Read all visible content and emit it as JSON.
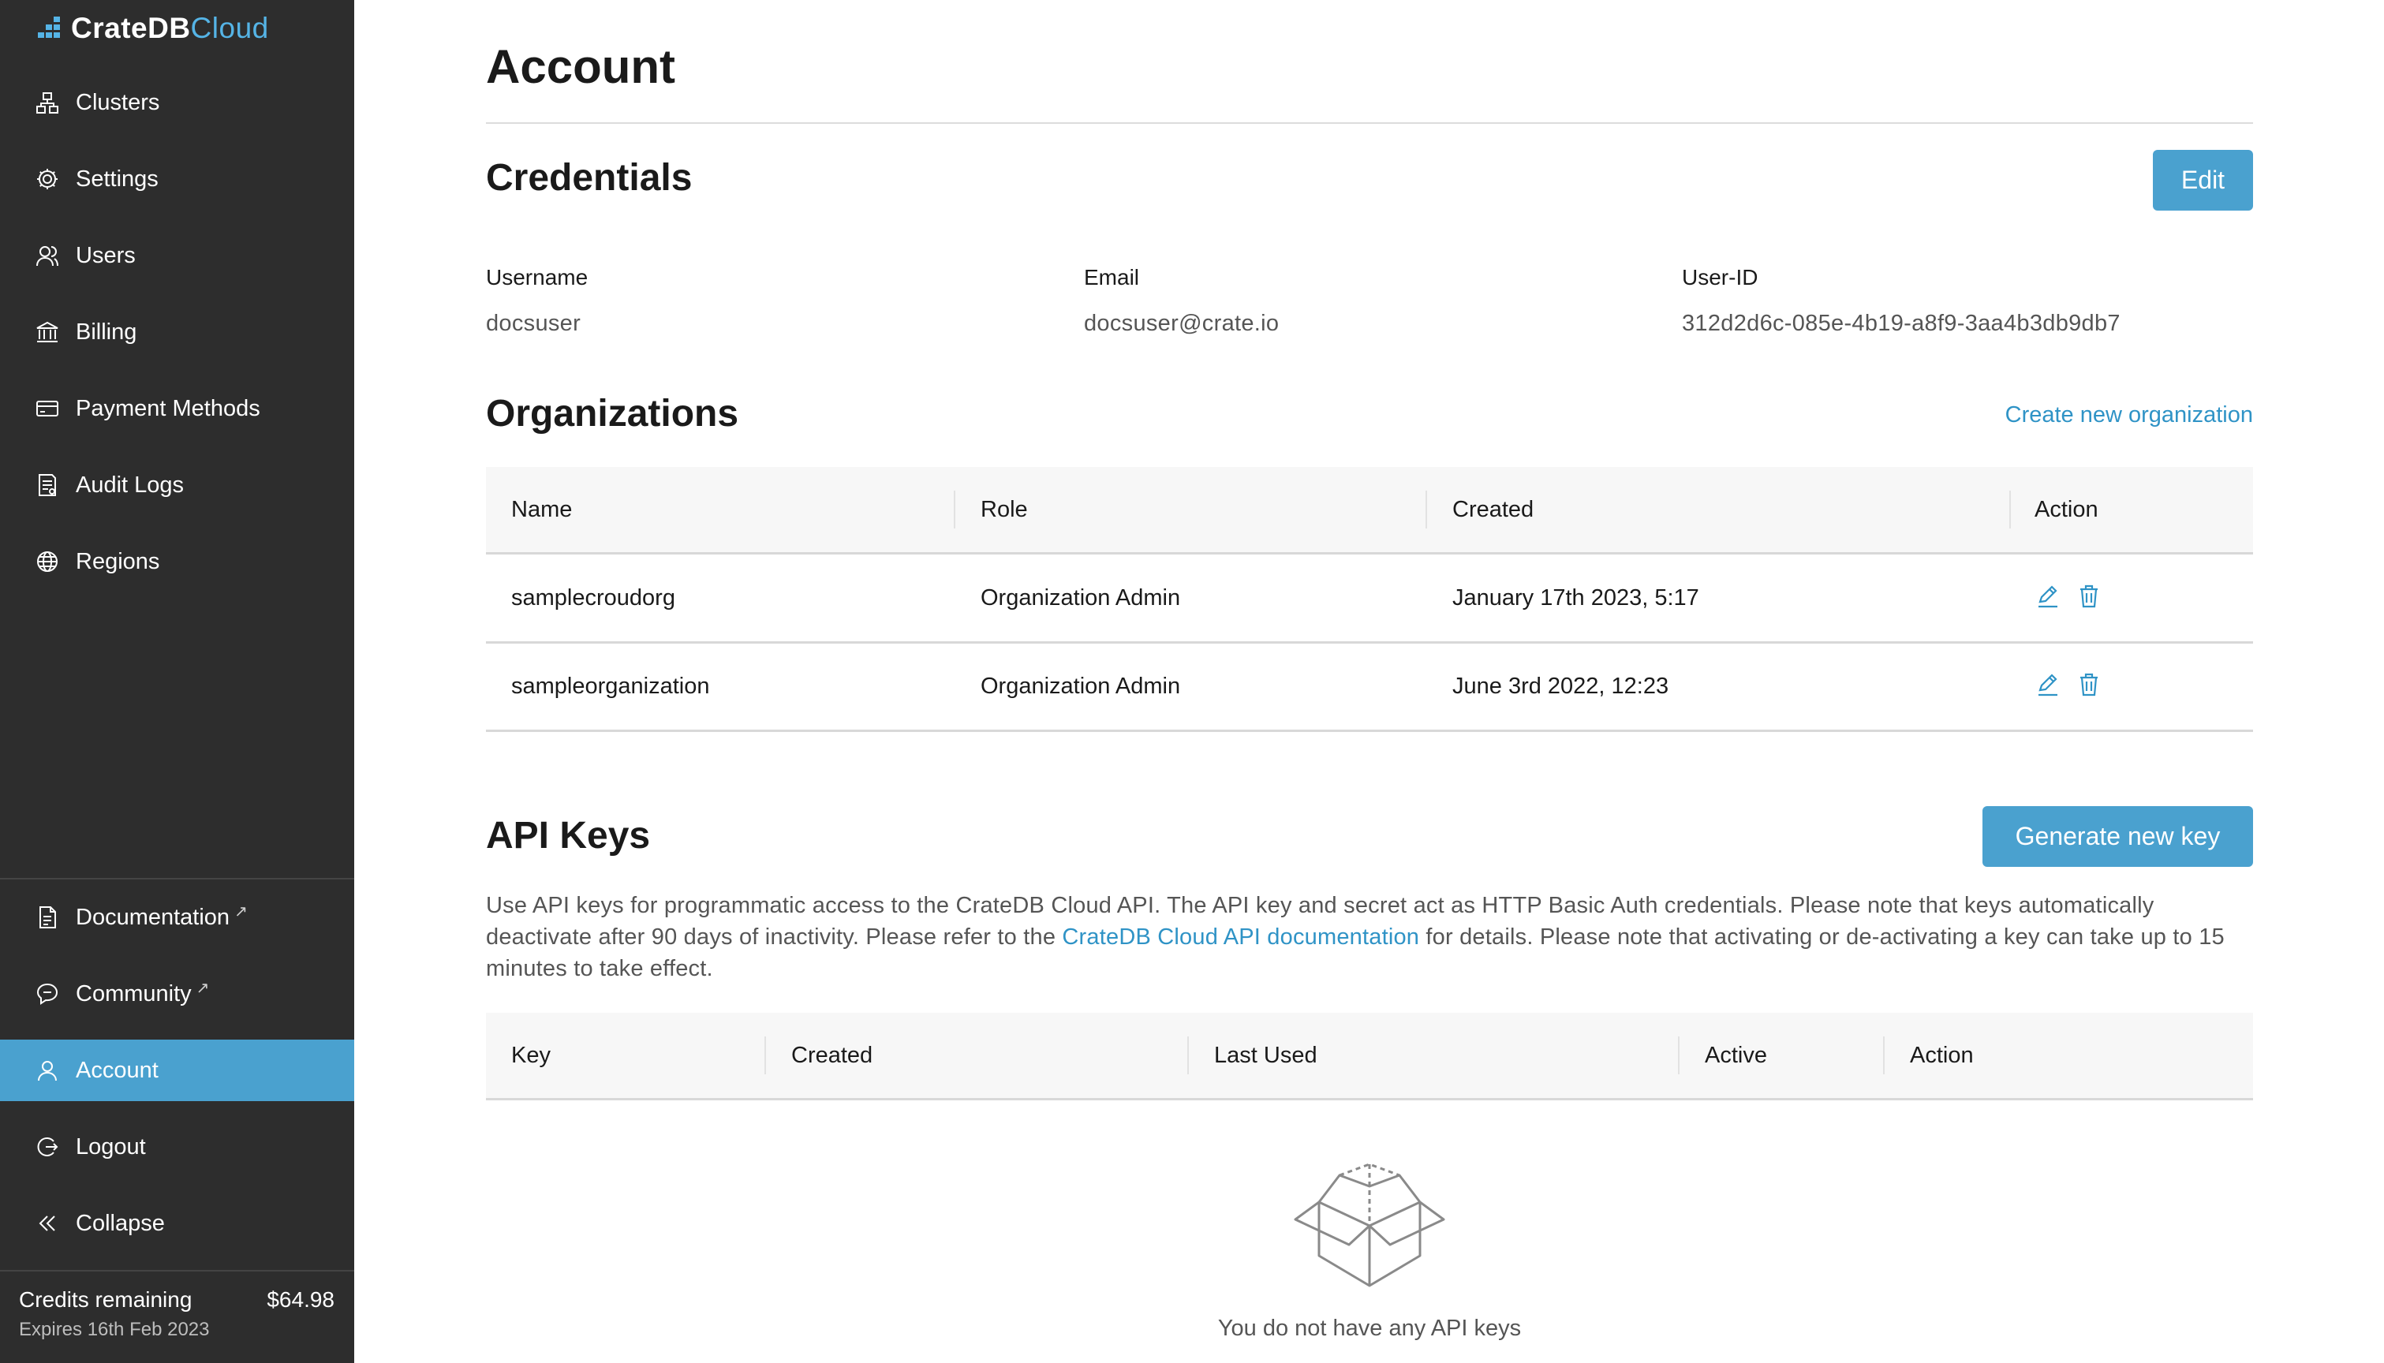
{
  "app": {
    "logo_part1": "CrateDB",
    "logo_part2": "Cloud",
    "accent_color": "#4aa1cf",
    "sidebar_bg": "#2d2d2d"
  },
  "sidebar": {
    "items": [
      {
        "label": "Clusters",
        "icon": "clusters-icon"
      },
      {
        "label": "Settings",
        "icon": "gear-icon"
      },
      {
        "label": "Users",
        "icon": "users-icon"
      },
      {
        "label": "Billing",
        "icon": "bank-icon"
      },
      {
        "label": "Payment Methods",
        "icon": "credit-card-icon"
      },
      {
        "label": "Audit Logs",
        "icon": "audit-log-icon"
      },
      {
        "label": "Regions",
        "icon": "globe-icon"
      }
    ],
    "bottom_items": [
      {
        "label": "Documentation",
        "icon": "document-icon",
        "external": true
      },
      {
        "label": "Community",
        "icon": "chat-icon",
        "external": true
      },
      {
        "label": "Account",
        "icon": "user-icon",
        "active": true
      },
      {
        "label": "Logout",
        "icon": "logout-icon"
      },
      {
        "label": "Collapse",
        "icon": "double-chevron-left-icon"
      }
    ],
    "credits": {
      "label": "Credits remaining",
      "amount": "$64.98",
      "expires": "Expires 16th Feb 2023"
    }
  },
  "page": {
    "title": "Account"
  },
  "credentials": {
    "heading": "Credentials",
    "edit_label": "Edit",
    "fields": [
      {
        "label": "Username",
        "value": "docsuser"
      },
      {
        "label": "Email",
        "value": "docsuser@crate.io"
      },
      {
        "label": "User-ID",
        "value": "312d2d6c-085e-4b19-a8f9-3aa4b3db9db7"
      }
    ]
  },
  "organizations": {
    "heading": "Organizations",
    "create_link": "Create new organization",
    "columns": [
      "Name",
      "Role",
      "Created",
      "Action"
    ],
    "rows": [
      {
        "name": "samplecroudorg",
        "role": "Organization Admin",
        "created": "January 17th 2023, 5:17"
      },
      {
        "name": "sampleorganization",
        "role": "Organization Admin",
        "created": "June 3rd 2022, 12:23"
      }
    ]
  },
  "api_keys": {
    "heading": "API Keys",
    "generate_label": "Generate new key",
    "description_part1": "Use API keys for programmatic access to the CrateDB Cloud API. The API key and secret act as HTTP Basic Auth credentials. Please note that keys automatically deactivate after 90 days of inactivity. Please refer to the ",
    "description_link": "CrateDB Cloud API documentation",
    "description_part2": " for details. Please note that activating or de-activating a key can take up to 15 minutes to take effect.",
    "columns": [
      "Key",
      "Created",
      "Last Used",
      "Active",
      "Action"
    ],
    "empty_text": "You do not have any API keys"
  }
}
